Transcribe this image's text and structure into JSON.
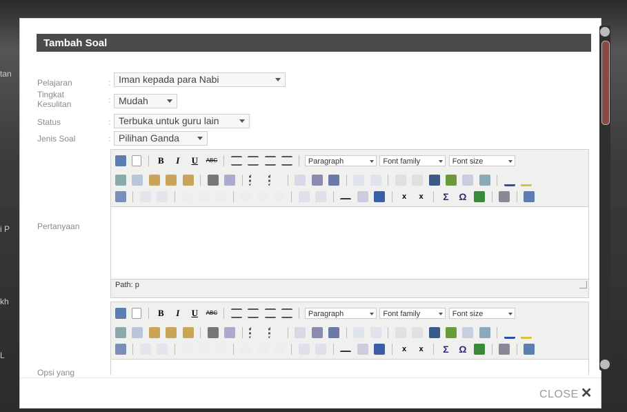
{
  "background": {
    "fragments": [
      "tan",
      "i P",
      "kh",
      "L"
    ]
  },
  "modal": {
    "title": "Tambah Soal",
    "close_label": "CLOSE",
    "close_icon": "✕"
  },
  "form": {
    "pelajaran": {
      "label": "Pelajaran",
      "value": "Iman kepada para Nabi"
    },
    "tingkat": {
      "label_line1": "Tingkat",
      "label_line2": "Kesulitan",
      "value": "Mudah"
    },
    "status": {
      "label": "Status",
      "value": "Terbuka untuk guru lain"
    },
    "jenis": {
      "label": "Jenis Soal",
      "value": "Pilihan Ganda"
    },
    "pertanyaan": {
      "label": "Pertanyaan",
      "path": "Path: p"
    },
    "opsi": {
      "label": "Opsi yang"
    },
    "colon": ":"
  },
  "editor": {
    "format": "Paragraph",
    "font_family": "Font family",
    "font_size": "Font size"
  },
  "colors": {
    "titlebar": "#4b4b4b",
    "scroll_thumb": "#8a4a44",
    "toolbar_bg": "#f0f0ee"
  }
}
